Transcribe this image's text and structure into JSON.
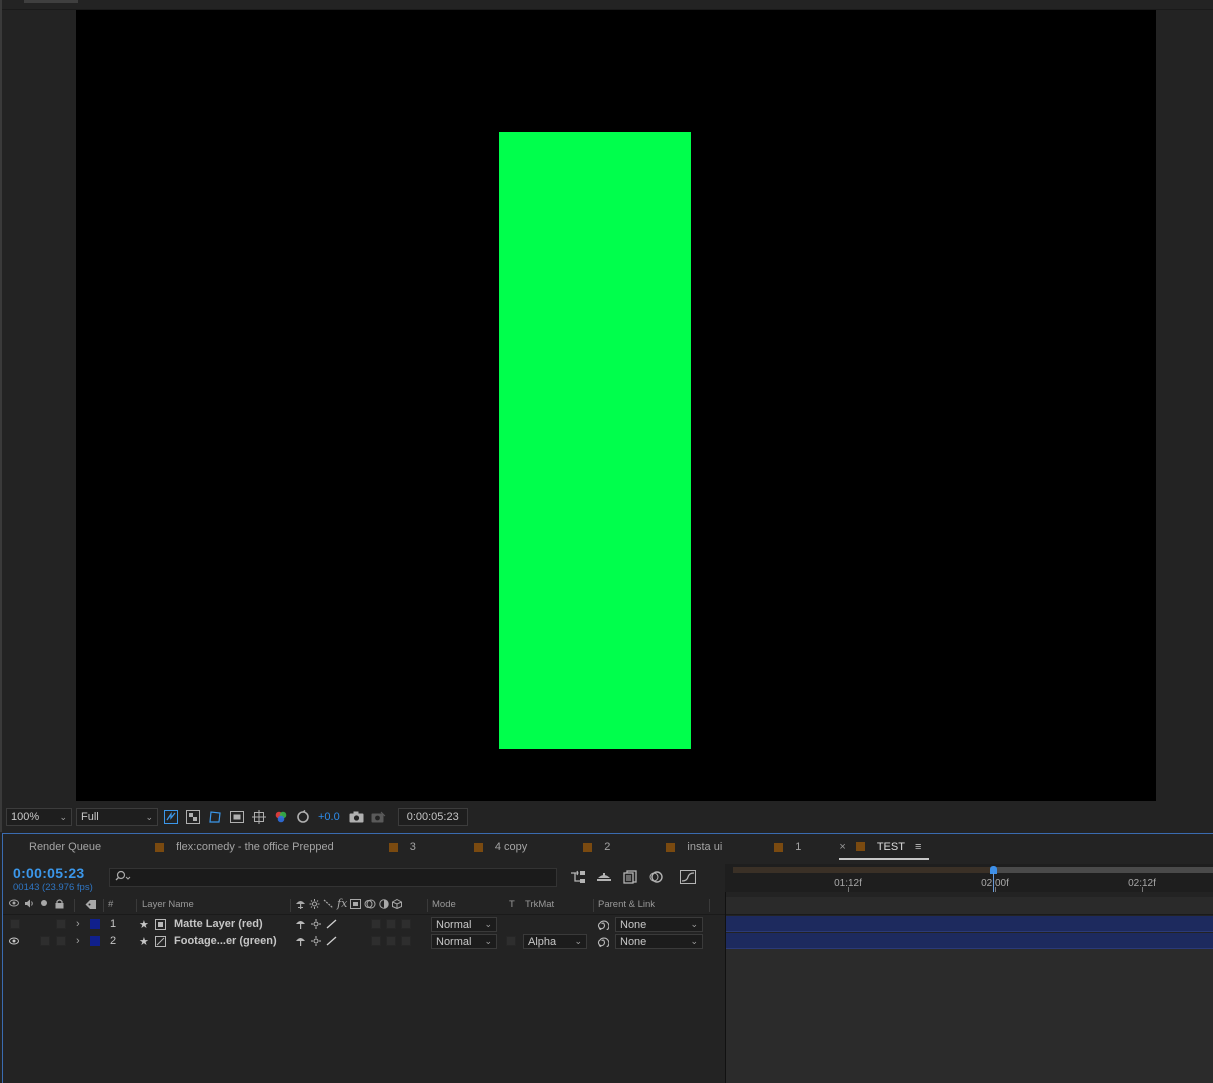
{
  "viewer": {
    "zoom": "100%",
    "resolution": "Full",
    "exposure": "+0.0",
    "timecode": "0:00:05:23",
    "colors": {
      "canvas": "#000000",
      "solid": "#00ff4c"
    }
  },
  "tabs": [
    {
      "label": "Render Queue",
      "swatch": false,
      "active": false
    },
    {
      "label": "flex:comedy - the office Prepped",
      "swatch": true,
      "active": false
    },
    {
      "label": "3",
      "swatch": true,
      "active": false
    },
    {
      "label": "4 copy",
      "swatch": true,
      "active": false
    },
    {
      "label": "2",
      "swatch": true,
      "active": false
    },
    {
      "label": "insta ui",
      "swatch": true,
      "active": false
    },
    {
      "label": "1",
      "swatch": true,
      "active": false
    },
    {
      "label": "TEST",
      "swatch": true,
      "active": true
    }
  ],
  "timeline": {
    "current_time": "0:00:05:23",
    "frame_info": "00143 (23.976 fps)",
    "search_placeholder": "",
    "ruler_labels": [
      "01:12f",
      "02:00f",
      "02:12f"
    ],
    "columns": {
      "layer_name": "Layer Name",
      "number": "#",
      "mode": "Mode",
      "t": "T",
      "trkmat": "TrkMat",
      "parent": "Parent & Link"
    },
    "layers": [
      {
        "number": "1",
        "name": "Matte Layer (red)",
        "mode": "Normal",
        "trkmat": "",
        "parent": "None",
        "visible": false
      },
      {
        "number": "2",
        "name": "Footage...er (green)",
        "mode": "Normal",
        "trkmat": "Alpha",
        "parent": "None",
        "visible": true
      }
    ],
    "colors": {
      "accent": "#3b97ea",
      "label": "#10208c",
      "track": "#1d2a5e"
    }
  }
}
